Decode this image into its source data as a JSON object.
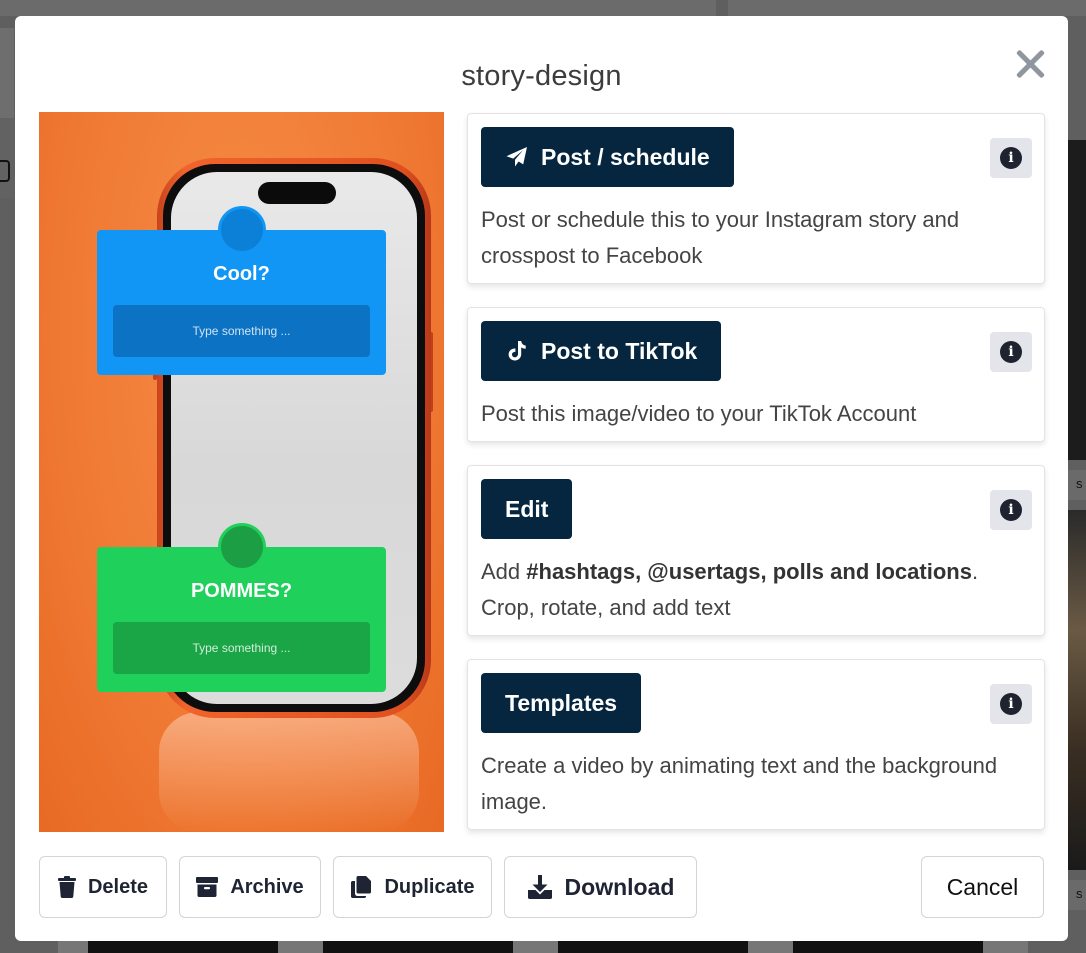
{
  "modal": {
    "title": "story-design"
  },
  "preview": {
    "card_top_title": "Cool?",
    "card_top_placeholder": "Type something ...",
    "card_bottom_title": "POMMES?",
    "card_bottom_placeholder": "Type something ...",
    "card_top_color": "#1196f5",
    "card_bottom_color": "#1fd05a"
  },
  "actions": [
    {
      "label": "Post / schedule",
      "icon": "paper-plane-icon",
      "description": "Post or schedule this to your Instagram story and crosspost to Facebook"
    },
    {
      "label": "Post to TikTok",
      "icon": "tiktok-icon",
      "description": "Post this image/video to your TikTok Account"
    },
    {
      "label": "Edit",
      "description_prefix": "Add ",
      "description_bold": "#hashtags, @usertags, polls and locations",
      "description_suffix": ".",
      "description_line2": "Crop, rotate, and add text"
    },
    {
      "label": "Templates",
      "description": "Create a video by animating text and the background image."
    }
  ],
  "footer": {
    "delete_label": "Delete",
    "archive_label": "Archive",
    "duplicate_label": "Duplicate",
    "download_label": "Download",
    "cancel_label": "Cancel"
  },
  "backdrop": {
    "label_partial_1": "s",
    "label_partial_2": "s"
  },
  "colors": {
    "primary_button": "#06263f",
    "info_icon_bg": "#e3e5ea",
    "preview_background": "#f07b35"
  }
}
